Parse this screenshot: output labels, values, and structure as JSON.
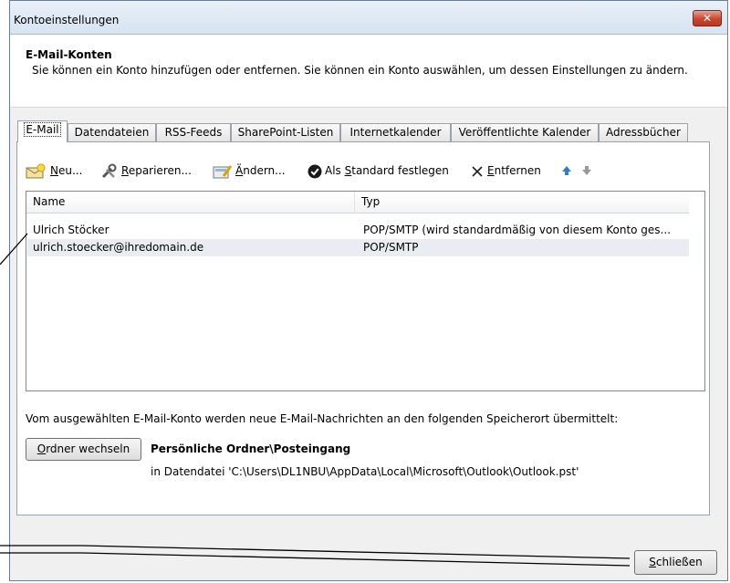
{
  "window": {
    "title": "Kontoeinstellungen",
    "close_label": "✕"
  },
  "header": {
    "title": "E-Mail-Konten",
    "description": "Sie können ein Konto hinzufügen oder entfernen. Sie können ein Konto auswählen, um dessen Einstellungen zu ändern."
  },
  "tabs": [
    {
      "label": "E-Mail"
    },
    {
      "label": "Datendateien"
    },
    {
      "label": "RSS-Feeds"
    },
    {
      "label": "SharePoint-Listen"
    },
    {
      "label": "Internetkalender"
    },
    {
      "label": "Veröffentlichte Kalender"
    },
    {
      "label": "Adressbücher"
    }
  ],
  "toolbar": {
    "new_u": "N",
    "new_rest": "eu...",
    "repair_u": "R",
    "repair_rest": "eparieren...",
    "change_u": "Ä",
    "change_rest": "ndern...",
    "default_pre": "Als ",
    "default_u": "S",
    "default_rest": "tandard festlegen",
    "remove_u": "E",
    "remove_rest": "ntfernen"
  },
  "list": {
    "columns": [
      "Name",
      "Typ"
    ],
    "rows": [
      {
        "name": "Ulrich Stöcker",
        "type": "POP/SMTP (wird standardmäßig von diesem Konto ges..."
      },
      {
        "name": "ulrich.stoecker@ihredomain.de",
        "type": "POP/SMTP"
      }
    ]
  },
  "delivery": {
    "text": "Vom ausgewählten E-Mail-Konto werden neue E-Mail-Nachrichten an den folgenden Speicherort übermittelt:",
    "button_u": "O",
    "button_rest": "rdner wechseln",
    "folder": "Persönliche Ordner\\Posteingang",
    "path": "in Datendatei 'C:\\Users\\DL1NBU\\AppData\\Local\\Microsoft\\Outlook\\Outlook.pst'"
  },
  "footer": {
    "close_u": "S",
    "close_rest": "chließen"
  },
  "colors": {
    "selected_row": "#e9edf1",
    "close_button": "#c9462e",
    "arrow_up": "#2a7fd4",
    "arrow_down": "#9a9a9a"
  }
}
